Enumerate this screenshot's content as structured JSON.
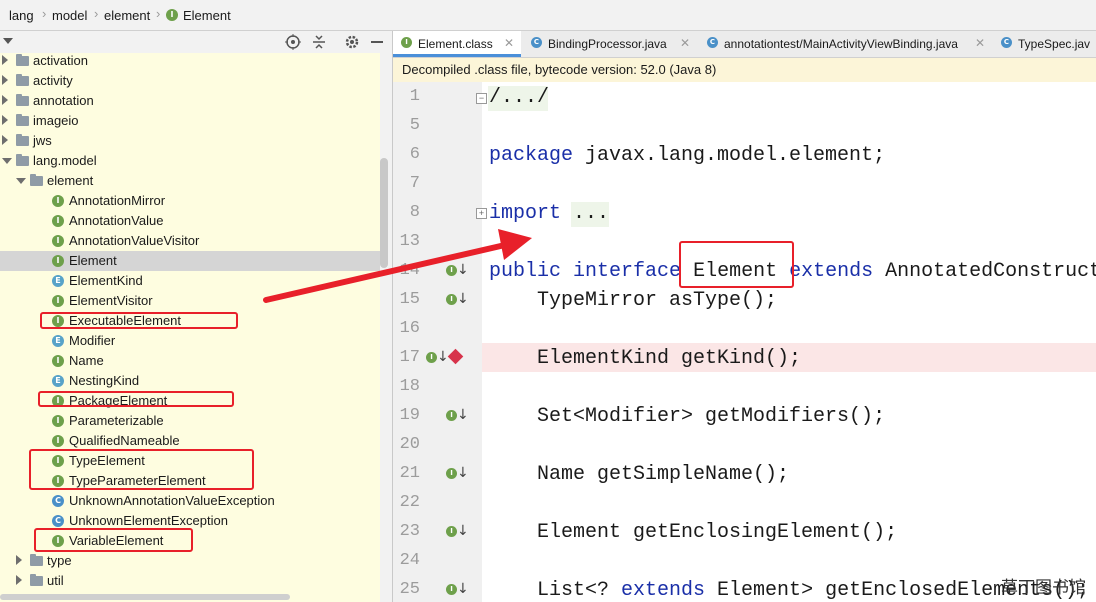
{
  "breadcrumb": [
    "lang",
    "model",
    "element",
    "Element"
  ],
  "tree": {
    "rows": [
      {
        "label": "activation",
        "kind": "folder",
        "level": 0,
        "expanded": false
      },
      {
        "label": "activity",
        "kind": "folder",
        "level": 0,
        "expanded": false
      },
      {
        "label": "annotation",
        "kind": "folder",
        "level": 0,
        "expanded": false
      },
      {
        "label": "imageio",
        "kind": "folder",
        "level": 0,
        "expanded": false
      },
      {
        "label": "jws",
        "kind": "folder",
        "level": 0,
        "expanded": false
      },
      {
        "label": "lang.model",
        "kind": "folder",
        "level": 0,
        "expanded": true
      },
      {
        "label": "element",
        "kind": "folder",
        "level": 1,
        "expanded": true
      },
      {
        "label": "AnnotationMirror",
        "kind": "I",
        "level": 2
      },
      {
        "label": "AnnotationValue",
        "kind": "I",
        "level": 2
      },
      {
        "label": "AnnotationValueVisitor",
        "kind": "I",
        "level": 2
      },
      {
        "label": "Element",
        "kind": "I",
        "level": 2,
        "selected": true
      },
      {
        "label": "ElementKind",
        "kind": "E",
        "level": 2
      },
      {
        "label": "ElementVisitor",
        "kind": "I",
        "level": 2
      },
      {
        "label": "ExecutableElement",
        "kind": "I",
        "level": 2
      },
      {
        "label": "Modifier",
        "kind": "E",
        "level": 2
      },
      {
        "label": "Name",
        "kind": "I",
        "level": 2
      },
      {
        "label": "NestingKind",
        "kind": "E",
        "level": 2
      },
      {
        "label": "PackageElement",
        "kind": "I",
        "level": 2
      },
      {
        "label": "Parameterizable",
        "kind": "I",
        "level": 2
      },
      {
        "label": "QualifiedNameable",
        "kind": "I",
        "level": 2
      },
      {
        "label": "TypeElement",
        "kind": "I",
        "level": 2
      },
      {
        "label": "TypeParameterElement",
        "kind": "I",
        "level": 2
      },
      {
        "label": "UnknownAnnotationValueException",
        "kind": "C",
        "level": 2
      },
      {
        "label": "UnknownElementException",
        "kind": "C",
        "level": 2
      },
      {
        "label": "VariableElement",
        "kind": "I",
        "level": 2
      },
      {
        "label": "type",
        "kind": "folder",
        "level": 1,
        "expanded": false
      },
      {
        "label": "util",
        "kind": "folder",
        "level": 1,
        "expanded": false
      }
    ]
  },
  "tabs": [
    {
      "label": "Element.class",
      "icon": "I",
      "active": true
    },
    {
      "label": "BindingProcessor.java",
      "icon": "C",
      "active": false
    },
    {
      "label": "annotationtest/MainActivityViewBinding.java",
      "icon": "C",
      "active": false
    },
    {
      "label": "TypeSpec.jav",
      "icon": "C",
      "active": false
    }
  ],
  "banner": "Decompiled .class file, bytecode version: 52.0 (Java 8)",
  "code_lines": [
    {
      "num": "1",
      "text": "/.../"
    },
    {
      "num": "5",
      "text": ""
    },
    {
      "num": "6",
      "text": "package javax.lang.model.element;"
    },
    {
      "num": "7",
      "text": ""
    },
    {
      "num": "8",
      "text": "import ..."
    },
    {
      "num": "13",
      "text": ""
    },
    {
      "num": "14",
      "text": "public interface Element extends AnnotatedConstruct"
    },
    {
      "num": "15",
      "text": "    TypeMirror asType();"
    },
    {
      "num": "16",
      "text": ""
    },
    {
      "num": "17",
      "text": "    ElementKind getKind();"
    },
    {
      "num": "18",
      "text": ""
    },
    {
      "num": "19",
      "text": "    Set<Modifier> getModifiers();"
    },
    {
      "num": "20",
      "text": ""
    },
    {
      "num": "21",
      "text": "    Name getSimpleName();"
    },
    {
      "num": "22",
      "text": ""
    },
    {
      "num": "23",
      "text": "    Element getEnclosingElement();"
    },
    {
      "num": "24",
      "text": ""
    },
    {
      "num": "25",
      "text": "    List<? extends Element> getEnclosedElements();"
    }
  ],
  "watermark": "草丁图书馆",
  "colors": {
    "tree_bg": "#fefde0",
    "keyword": "#1a2fa8",
    "highlight": "#e8202a",
    "banner": "#fcf5d8"
  }
}
